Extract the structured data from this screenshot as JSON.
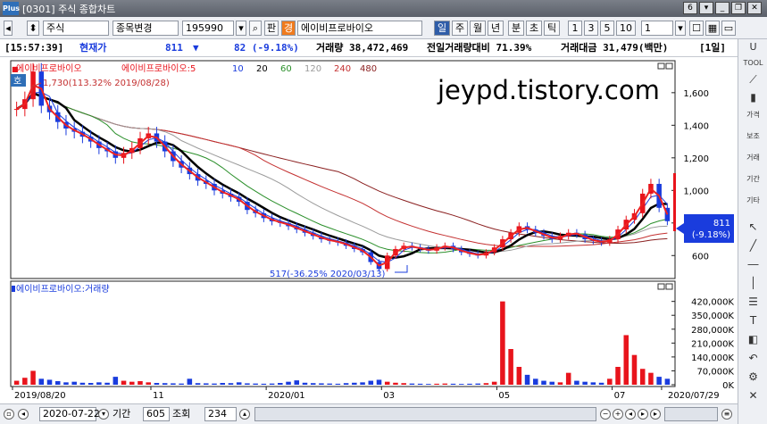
{
  "window": {
    "title": "[0301] 주식 종합차트",
    "badge": "6"
  },
  "toolbar": {
    "market": "주식",
    "change_code": "종목변경",
    "code": "195990",
    "pan": "판",
    "kyung": "경",
    "stock_name": "에이비프로바이오",
    "period_buttons": [
      "일",
      "주",
      "월",
      "년",
      "분",
      "초",
      "틱"
    ],
    "unit_buttons": [
      "1",
      "3",
      "5",
      "10"
    ],
    "unit_value": "1"
  },
  "status": {
    "time": "[15:57:39]",
    "price_label": "현재가",
    "price": "811",
    "arrow": "▼",
    "change": "82 (-9.18%)",
    "volume": "거래량 38,472,469",
    "prev_vol_ratio": "전일거래량대비 71.39%",
    "amount": "거래대금 31,479(백만)",
    "mode": "[1일]"
  },
  "legend": {
    "name": "에이비프로바이오",
    "ma_prefix": "에이비프로바이오:5",
    "items": [
      "10",
      "20",
      "60",
      "120",
      "240",
      "480"
    ],
    "volume_label": "에이비프로바이오:거래량"
  },
  "watermark": "jeypd.tistory.com",
  "annotations": {
    "high": "1,730(113.32% 2019/08/28)",
    "low": "517(-36.25% 2020/03/13)",
    "current_price": "811",
    "current_pct": "(-9.18%)",
    "ho": "호"
  },
  "bottom": {
    "date": "2020-07-22",
    "period_label": "기간",
    "period_value": "605",
    "lookup": "조회",
    "count": "234"
  },
  "rightbar": {
    "tool": "TOOL",
    "items": [
      "가격",
      "보조",
      "거래",
      "기간",
      "기타"
    ]
  },
  "colors": {
    "price_line": "#e8141c",
    "ma5": "#ee2222",
    "ma10": "#1a3cdd",
    "ma20": "#000000",
    "ma60": "#2a8f2a",
    "ma120": "#9a9a9a",
    "ma240": "#c43030",
    "ma480": "#8a1f1f",
    "up": "#e8141c",
    "down": "#1a3cdd"
  },
  "chart_data": {
    "type": "candlestick",
    "x_ticks": [
      "2019/08/20",
      "11",
      "2020/01",
      "03",
      "05",
      "07",
      "2020/07/29"
    ],
    "y_ticks": [
      "1,600",
      "1,400",
      "1,200",
      "1,000",
      "800",
      "600"
    ],
    "y_values": [
      1600,
      1400,
      1200,
      1000,
      800,
      600
    ],
    "ylim": [
      470,
      1780
    ],
    "volume_ticks": [
      "420,000K",
      "350,000K",
      "280,000K",
      "210,000K",
      "140,000K",
      "70,000K",
      "0K"
    ],
    "volume_values": [
      420000,
      350000,
      280000,
      210000,
      140000,
      70000,
      0
    ],
    "volume_ylim": [
      0,
      450000
    ],
    "close_series": [
      1500,
      1560,
      1730,
      1520,
      1480,
      1420,
      1380,
      1360,
      1330,
      1300,
      1260,
      1240,
      1200,
      1230,
      1260,
      1320,
      1350,
      1300,
      1240,
      1180,
      1140,
      1100,
      1060,
      1040,
      1000,
      980,
      960,
      930,
      880,
      860,
      830,
      810,
      800,
      780,
      760,
      740,
      720,
      700,
      690,
      680,
      660,
      640,
      620,
      560,
      517,
      600,
      640,
      660,
      650,
      640,
      630,
      650,
      660,
      640,
      620,
      610,
      600,
      620,
      650,
      700,
      740,
      780,
      760,
      740,
      720,
      700,
      720,
      740,
      730,
      700,
      690,
      680,
      700,
      760,
      820,
      860,
      980,
      1040,
      893,
      811
    ],
    "volume_series": [
      20000,
      35000,
      70000,
      30000,
      25000,
      18000,
      12000,
      15000,
      10000,
      9000,
      12000,
      10000,
      40000,
      20000,
      15000,
      18000,
      12000,
      9000,
      8000,
      7000,
      6000,
      30000,
      8000,
      7000,
      6000,
      9000,
      8000,
      12000,
      7000,
      6000,
      5000,
      6000,
      9000,
      15000,
      22000,
      10000,
      8000,
      7000,
      6000,
      5000,
      8000,
      10000,
      12000,
      20000,
      25000,
      15000,
      10000,
      8000,
      6000,
      5000,
      4000,
      5000,
      6000,
      5000,
      4000,
      5000,
      6000,
      8000,
      15000,
      420000,
      180000,
      90000,
      50000,
      30000,
      20000,
      15000,
      12000,
      60000,
      20000,
      15000,
      12000,
      10000,
      30000,
      90000,
      250000,
      150000,
      80000,
      60000,
      40000,
      30000
    ]
  }
}
